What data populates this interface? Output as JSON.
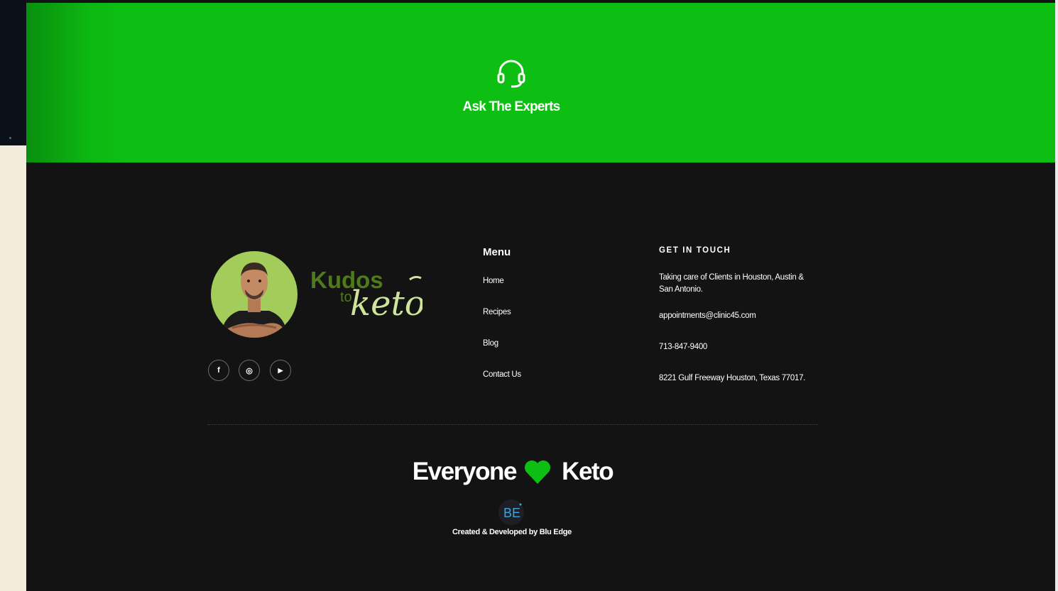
{
  "colors": {
    "accent_green": "#0cbf12",
    "footer_bg": "#131313",
    "avatar_bg": "#a3cc5a",
    "logo_green": "#4f7a19",
    "logo_light": "#cfe39a"
  },
  "hero": {
    "icon": "headset-icon",
    "title": "Ask The Experts"
  },
  "brand": {
    "logo_kudos": "Kudos",
    "logo_to": "to",
    "logo_keto": "keto"
  },
  "social": [
    {
      "name": "facebook-icon",
      "glyph": "f"
    },
    {
      "name": "instagram-icon",
      "glyph": "◎"
    },
    {
      "name": "youtube-icon",
      "glyph": "▶"
    }
  ],
  "menu": {
    "heading": "Menu",
    "items": [
      "Home",
      "Recipes",
      "Blog",
      "Contact Us"
    ]
  },
  "contact": {
    "heading": "GET IN TOUCH",
    "service_area_line1": "Taking care of Clients in Houston, Austin &",
    "service_area_line2": "San Antonio.",
    "email": "appointments@clinic45.com",
    "phone": "713-847-9400",
    "address": "8221 Gulf Freeway Houston, Texas 77017."
  },
  "tagline": {
    "left": "Everyone",
    "icon": "heart-icon",
    "right": "Keto"
  },
  "credit": {
    "logo_text": "BE",
    "text": "Created & Developed by Blu Edge"
  }
}
